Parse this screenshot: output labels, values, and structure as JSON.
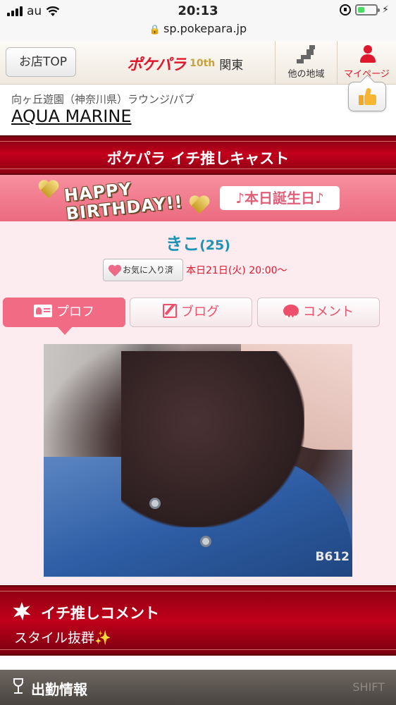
{
  "status_bar": {
    "carrier": "au",
    "time": "20:13",
    "battery_level": 0.35
  },
  "browser": {
    "url": "sp.pokepara.jp"
  },
  "header": {
    "back_label": "お店TOP",
    "logo_text": "ポケパラ",
    "logo_badge": "10th",
    "logo_region": "関東",
    "nav_region_label": "他の地域",
    "nav_mypage_label": "マイページ"
  },
  "shop": {
    "area": "向ヶ丘遊園（神奈川県）ラウンジ/パブ",
    "name": "AQUA MARINE"
  },
  "banner": {
    "title": "ポケパラ イチ推しキャスト"
  },
  "birthday": {
    "art_text_line1": "HAPPY",
    "art_text_line2": "BIRTHDAY!!",
    "label": "♪本日誕生日♪"
  },
  "cast": {
    "name": "きこ",
    "age": "(25)",
    "favorite_label": "お気に入り済",
    "schedule": "本日21日(火) 20:00〜"
  },
  "tabs": [
    {
      "label": "プロフ",
      "icon": "profile-card-icon",
      "active": true
    },
    {
      "label": "ブログ",
      "icon": "blog-edit-icon",
      "active": false
    },
    {
      "label": "コメント",
      "icon": "comment-bubble-icon",
      "active": false
    }
  ],
  "photo": {
    "watermark": "B612"
  },
  "comment_section": {
    "title": "イチ推しコメント",
    "body": "スタイル抜群",
    "sparkle": "✨"
  },
  "footer": {
    "title": "出勤情報",
    "shift_label": "SHIFT"
  },
  "colors": {
    "brand_red": "#e0182d",
    "banner_red": "#c4001c",
    "pink_accent": "#f26b84",
    "cast_name_blue": "#1e93b5",
    "footer_brown": "#4a4541"
  }
}
